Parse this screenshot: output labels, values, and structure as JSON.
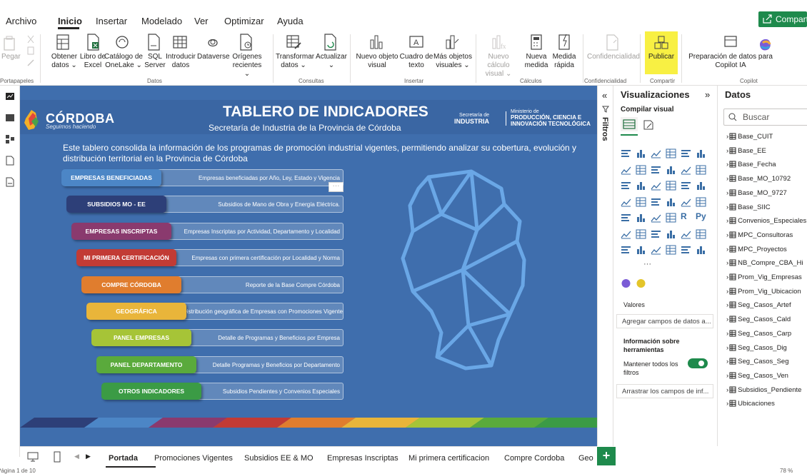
{
  "menu": {
    "items": [
      "Archivo",
      "Inicio",
      "Insertar",
      "Modelado",
      "Ver",
      "Optimizar",
      "Ayuda"
    ],
    "share": "Compartir"
  },
  "ribbon": {
    "paste": "Pegar",
    "clipboard_group": "Portapapeles",
    "get_data": "Obtener datos ⌄",
    "excel": "Libro de Excel",
    "onelake": "Catálogo de OneLake ⌄",
    "sql": "SQL Server",
    "enter_data": "Introducir datos",
    "dataverse": "Dataverse",
    "recent": "Orígenes recientes ⌄",
    "data_group": "Datos",
    "transform": "Transformar datos ⌄",
    "refresh": "Actualizar ⌄",
    "queries_group": "Consultas",
    "new_visual": "Nuevo objeto visual",
    "textbox": "Cuadro de texto",
    "more_visuals": "Más objetos visuales ⌄",
    "insert_group": "Insertar",
    "new_calc": "Nuevo cálculo visual ⌄",
    "new_measure": "Nueva medida",
    "quick_measure": "Medida rápida",
    "calc_group": "Cálculos",
    "sensitivity": "Confidencialidad",
    "sensitivity_group": "Confidencialidad",
    "publish": "Publicar",
    "share_group": "Compartir",
    "copilot_prep": "Preparación de datos para Copilot IA",
    "copilot_group": "Copilot"
  },
  "report": {
    "logo": "CÓRDOBA",
    "logo_sub": "Seguimos haciendo",
    "title": "TABLERO DE INDICADORES",
    "subtitle": "Secretaría de Industria de la Provincia de Córdoba",
    "sec_small": "Secretaría de",
    "sec_big": "INDUSTRIA",
    "min_small": "Ministerio de",
    "min_big1": "PRODUCCIÓN, CIENCIA E",
    "min_big2": "INNOVACIÓN TECNOLÓGICA",
    "intro": "Este tablero consolida la información de los programas de promoción industrial vigentes, permitiendo analizar su cobertura, evolución y distribución territorial en la Provincia de Córdoba",
    "more": "···",
    "nav": [
      {
        "label": "EMPRESAS BENEFICIADAS",
        "desc": "Empresas beneficiadas por Año, Ley, Estado y Vigencia",
        "color": "#4c86c6"
      },
      {
        "label": "SUBSIDIOS MO - EE",
        "desc": "Subsidios de Mano de Obra y Energía Eléctrica.",
        "color": "#2d3f78"
      },
      {
        "label": "EMPRESAS INSCRIPTAS",
        "desc": "Empresas Inscriptas por Actividad, Departamento y Localidad",
        "color": "#8a3a6e"
      },
      {
        "label": "MI PRIMERA CERTIFICACIÓN",
        "desc": "Empresas con primera certificación por Localidad y Norma",
        "color": "#c23b35"
      },
      {
        "label": "COMPRE CÓRDOBA",
        "desc": "Reporte de la Base Compre Córdoba",
        "color": "#e07d2e"
      },
      {
        "label": "GEOGRÁFICA",
        "desc": "Distribución geográfica de Empresas con Promociones Vigentes",
        "color": "#e9b53a"
      },
      {
        "label": "PANEL EMPRESAS",
        "desc": "Detalle de Programas y Beneficios por Empresa",
        "color": "#a6c437"
      },
      {
        "label": "PANEL DEPARTAMENTO",
        "desc": "Detalle Programas y Beneficios por Departamento",
        "color": "#5aaa3c"
      },
      {
        "label": "OTROS INDICADORES",
        "desc": "Subsidios Pendientes y Convenios Especiales",
        "color": "#3b9b45"
      }
    ]
  },
  "tabs": [
    "Portada",
    "Promociones Vigentes",
    "Subsidios EE & MO",
    "Empresas Inscriptas",
    "Mi primera certificacion",
    "Compre Cordoba",
    "Geo"
  ],
  "status": "Página 1 de 10",
  "zoom": "78 %",
  "filters": "Filtros",
  "viz": {
    "title": "Visualizaciones",
    "build": "Compilar visual",
    "values": "Valores",
    "values_drop": "Agregar campos de datos a...",
    "tooltip": "Información sobre herramientas",
    "keep": "Mantener todos los filtros",
    "drill_drop": "Arrastrar los campos de inf..."
  },
  "data": {
    "title": "Datos",
    "search_placeholder": "Buscar",
    "tables": [
      "Base_CUIT",
      "Base_EE",
      "Base_Fecha",
      "Base_MO_10792",
      "Base_MO_9727",
      "Base_SIIC",
      "Convenios_Especiales",
      "MPC_Consultoras",
      "MPC_Proyectos",
      "NB_Compre_CBA_Hi",
      "Prom_Vig_Empresas",
      "Prom_Vig_Ubicacion",
      "Seg_Casos_Artef",
      "Seg_Casos_Cald",
      "Seg_Casos_Carp",
      "Seg_Casos_Dig",
      "Seg_Casos_Seg",
      "Seg_Casos_Ven",
      "Subsidios_Pendiente",
      "Ubicaciones"
    ]
  }
}
